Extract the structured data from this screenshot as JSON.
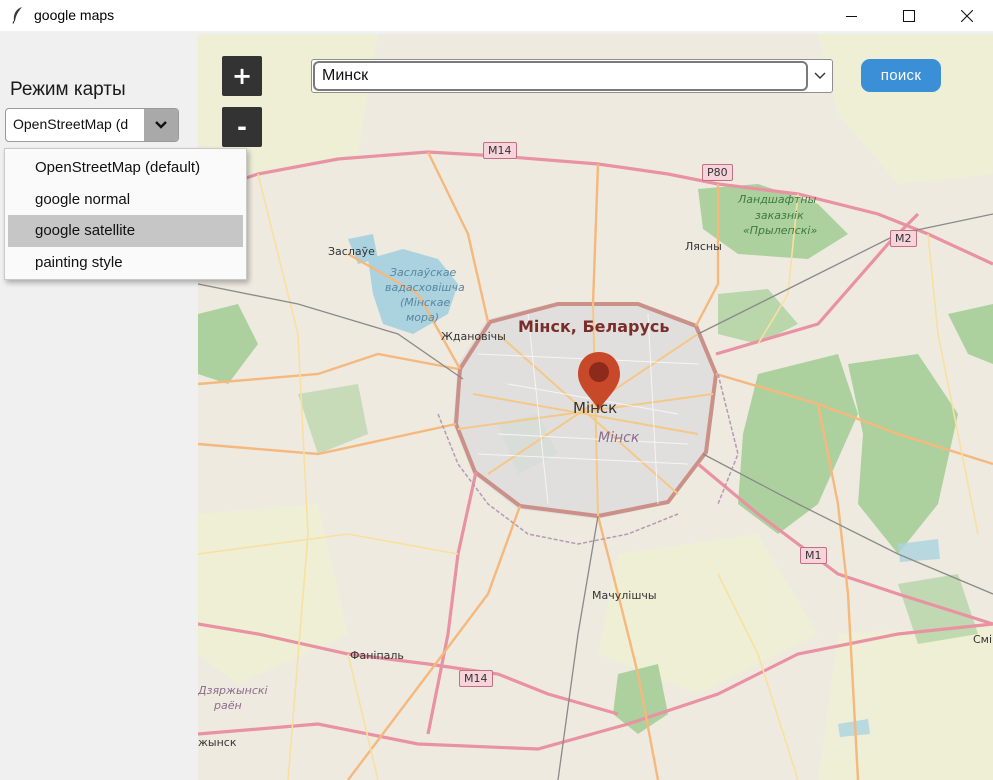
{
  "window": {
    "title": "google maps"
  },
  "left_panel": {
    "mode_label": "Режим карты",
    "mode_select_value": "OpenStreetMap (d",
    "dropdown_options": [
      {
        "label": "OpenStreetMap (default)",
        "selected": false
      },
      {
        "label": "google normal",
        "selected": false
      },
      {
        "label": "google satellite",
        "selected": true
      },
      {
        "label": "painting style",
        "selected": false
      }
    ]
  },
  "toolbar": {
    "zoom_in_label": "+",
    "zoom_out_label": "-",
    "search_value": "Минск",
    "search_button_label": "поиск"
  },
  "map": {
    "marker_label": "Мінск, Беларусь",
    "place_labels": {
      "minsk_city": "Мінск",
      "minsk_district": "Мінск",
      "zaslauye": "Заслаўе",
      "lake_line1": "Заслаўскае",
      "lake_line2": "вадасховішча",
      "lake_line3": "(Мінскае",
      "lake_line4": "мора)",
      "zhdanovichy": "Ждановічы",
      "lyasny": "Лясны",
      "reserve_line1": "Ландшафтны",
      "reserve_line2": "заказнік",
      "reserve_line3": "«Прылепскі»",
      "machulishchy": "Мачулішчы",
      "fanipal": "Фаніпаль",
      "dzyarzhynsk_line1": "Дзяржынскі",
      "dzyarzhynsk_line2": "раён",
      "dzyarzhynsk_town": "жынск",
      "smi": "Смі"
    },
    "road_shields": {
      "m14_top": "M14",
      "p80": "P80",
      "m2": "M2",
      "m1": "M1",
      "m14_bottom": "M14"
    },
    "colors": {
      "background": "#eeeae0",
      "forest": "#add19e",
      "water": "#aad3df",
      "city": "#dddddd",
      "motorway": "#e892a2",
      "primary": "#fcd6a4",
      "marker": "#c8492a"
    }
  }
}
